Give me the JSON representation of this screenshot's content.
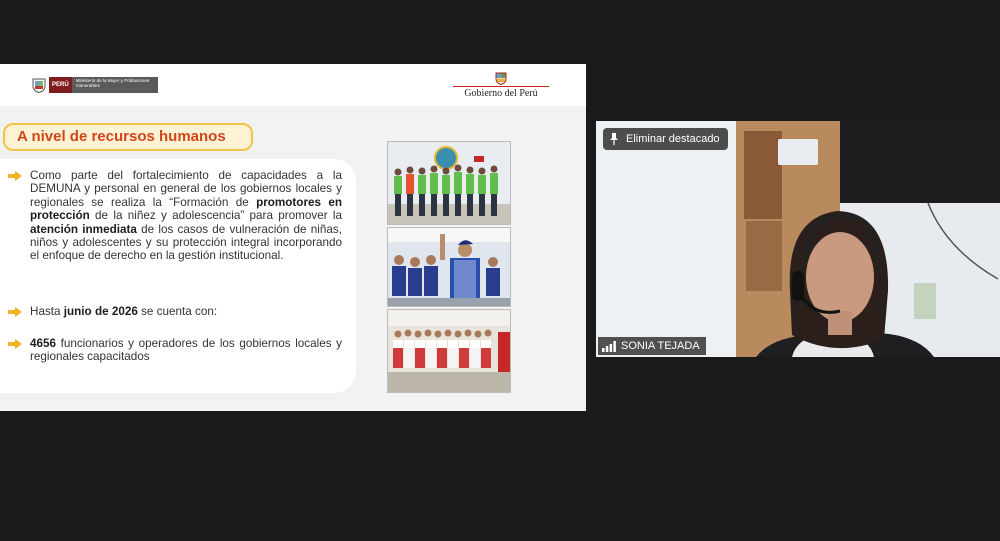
{
  "slide": {
    "header": {
      "peru_label": "PERÚ",
      "ministry_name": "Ministerio de la Mujer y Poblaciones Vulnerables",
      "government_label": "Gobierno del Perú"
    },
    "section_title": "A nivel de recursos humanos",
    "bullets": [
      {
        "segments": [
          {
            "t": "Como parte del fortalecimiento de capacidades a la DEMUNA y personal en general de los gobiernos locales y regionales se realiza la “Formación de ",
            "b": false
          },
          {
            "t": "promotores en protección",
            "b": true
          },
          {
            "t": " de la niñez y adolescencia” para promover la ",
            "b": false
          },
          {
            "t": "atención inmediata",
            "b": true
          },
          {
            "t": " de los casos de vulneración de niñas, niños y adolescentes y su protección integral incorporando el enfoque de derecho en la gestión institucional.",
            "b": false
          }
        ]
      },
      {
        "segments": [
          {
            "t": "Hasta ",
            "b": false
          },
          {
            "t": "junio de 2026",
            "b": true
          },
          {
            "t": " se cuenta con:",
            "b": false
          }
        ]
      },
      {
        "segments": [
          {
            "t": "4656",
            "b": true
          },
          {
            "t": " funcionarios y operadores de los gobiernos locales y regionales capacitados",
            "b": false
          }
        ]
      }
    ],
    "accent_color": "#f3c24a",
    "title_color": "#d1451b"
  },
  "video": {
    "unpin_label": "Eliminar destacado",
    "participant_name": "SONIA TEJADA"
  }
}
